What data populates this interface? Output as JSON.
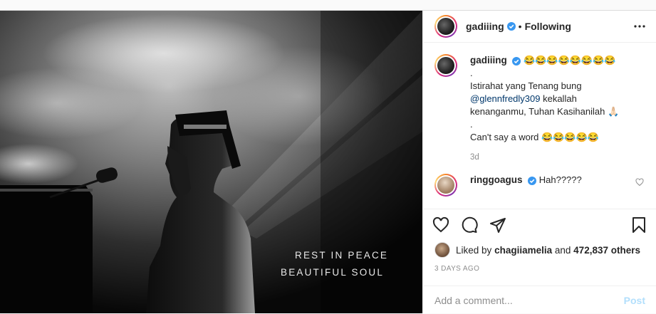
{
  "photo": {
    "line1": "REST IN PEACE",
    "line2": "BEAUTIFUL SOUL"
  },
  "header": {
    "username": "gadiiing",
    "separator": "•",
    "follow_status": "Following"
  },
  "caption": {
    "username": "gadiiing",
    "emojis": "😂😂😂😂😂😂😂😂",
    "line_dot1": ".",
    "text1": "Istirahat yang Tenang bung",
    "mention": "@glennfredly309",
    "text2": " kekallah kenanganmu, Tuhan Kasihanilah 🙏🏻",
    "line_dot2": ".",
    "text3": "Can't say a word 😂😂😂😂😂",
    "time": "3d"
  },
  "reply": {
    "username": "ringgoagus",
    "text": "Hah?????"
  },
  "likes": {
    "prefix": "Liked by ",
    "user": "chagiiamelia",
    "middle": " and ",
    "count": "472,837 others"
  },
  "posted": "3 DAYS AGO",
  "comment_box": {
    "placeholder": "Add a comment...",
    "post_label": "Post"
  },
  "colors": {
    "verified": "#3897f0",
    "link": "#00376b",
    "muted": "#8e8e8e",
    "post_disabled": "#b2dffc"
  },
  "icons": [
    "heart-icon",
    "comment-icon",
    "share-icon",
    "bookmark-icon",
    "verified-badge-icon"
  ]
}
